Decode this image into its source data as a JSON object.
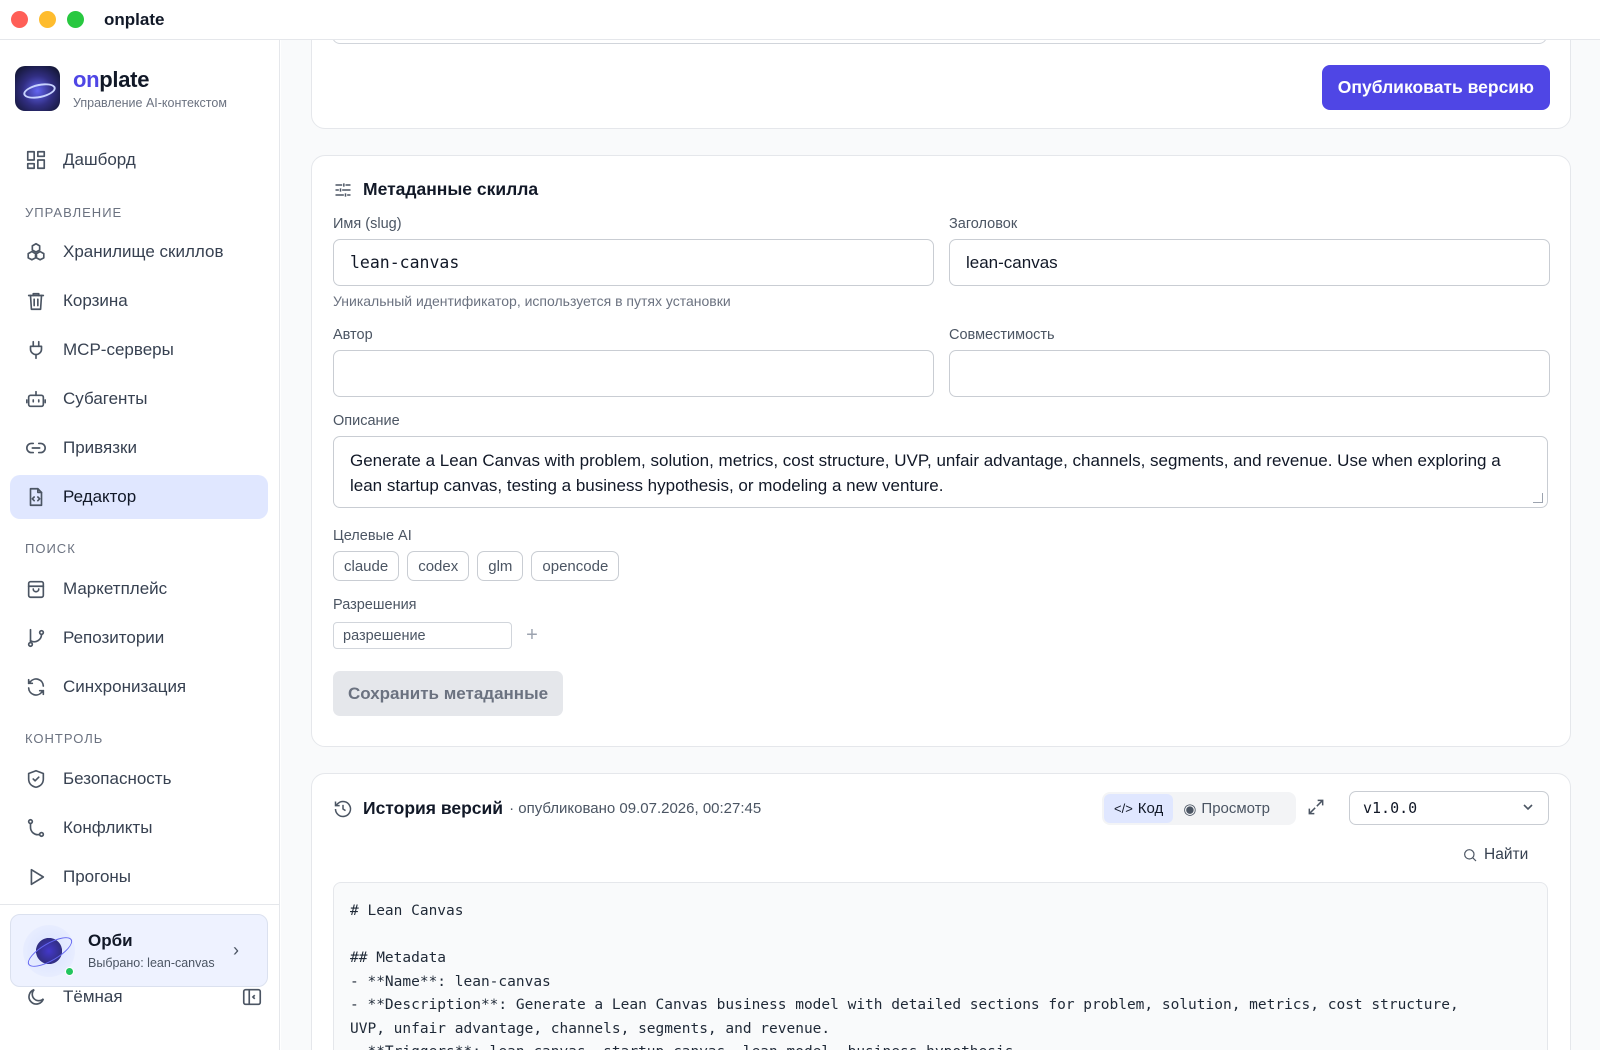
{
  "window": {
    "title": "onplate"
  },
  "brand": {
    "name_prefix": "on",
    "name_suffix": "plate",
    "subtitle": "Управление AI-контекстом"
  },
  "nav": {
    "dashboard": "Дашборд",
    "section_manage": "Управление",
    "skills": "Хранилище скиллов",
    "trash": "Корзина",
    "mcp": "MCP-серверы",
    "subagents": "Субагенты",
    "bindings": "Привязки",
    "editor": "Редактор",
    "section_search": "Поиск",
    "marketplace": "Маркетплейс",
    "repos": "Репозитории",
    "sync": "Синхронизация",
    "section_control": "Контроль",
    "security": "Безопасность",
    "conflicts": "Конфликты",
    "runs": "Прогоны"
  },
  "orbi": {
    "name": "Орби",
    "selected": "Выбрано: lean-canvas"
  },
  "theme": {
    "label": "Тёмная"
  },
  "publish": {
    "button": "Опубликовать версию"
  },
  "meta": {
    "title": "Метаданные скилла",
    "slug_label": "Имя (slug)",
    "slug_value": "lean-canvas",
    "slug_hint": "Уникальный идентификатор, используется в путях установки",
    "title_label": "Заголовок",
    "title_value": "lean-canvas",
    "author_label": "Автор",
    "author_value": "",
    "compat_label": "Совместимость",
    "compat_value": "",
    "desc_label": "Описание",
    "desc_value": "Generate a Lean Canvas with problem, solution, metrics, cost structure, UVP, unfair advantage, channels, segments, and revenue. Use when exploring a lean startup canvas, testing a business hypothesis, or modeling a new venture.",
    "targets_label": "Целевые AI",
    "targets": [
      "claude",
      "codex",
      "glm",
      "opencode"
    ],
    "perms_label": "Разрешения",
    "perm_placeholder": "разрешение",
    "perm_add": "+",
    "save_button": "Сохранить метаданные"
  },
  "history": {
    "title": "История версий",
    "meta": "· опубликовано 09.07.2026, 00:27:45",
    "tab_code": "Код",
    "tab_preview": "Просмотр",
    "version": "v1.0.0",
    "find": "Найти",
    "code": "# Lean Canvas\n\n## Metadata\n- **Name**: lean-canvas\n- **Description**: Generate a Lean Canvas business model with detailed sections for problem, solution, metrics, cost structure,\nUVP, unfair advantage, channels, segments, and revenue.\n- **Triggers**: lean canvas, startup canvas, lean model, business hypothesis"
  }
}
